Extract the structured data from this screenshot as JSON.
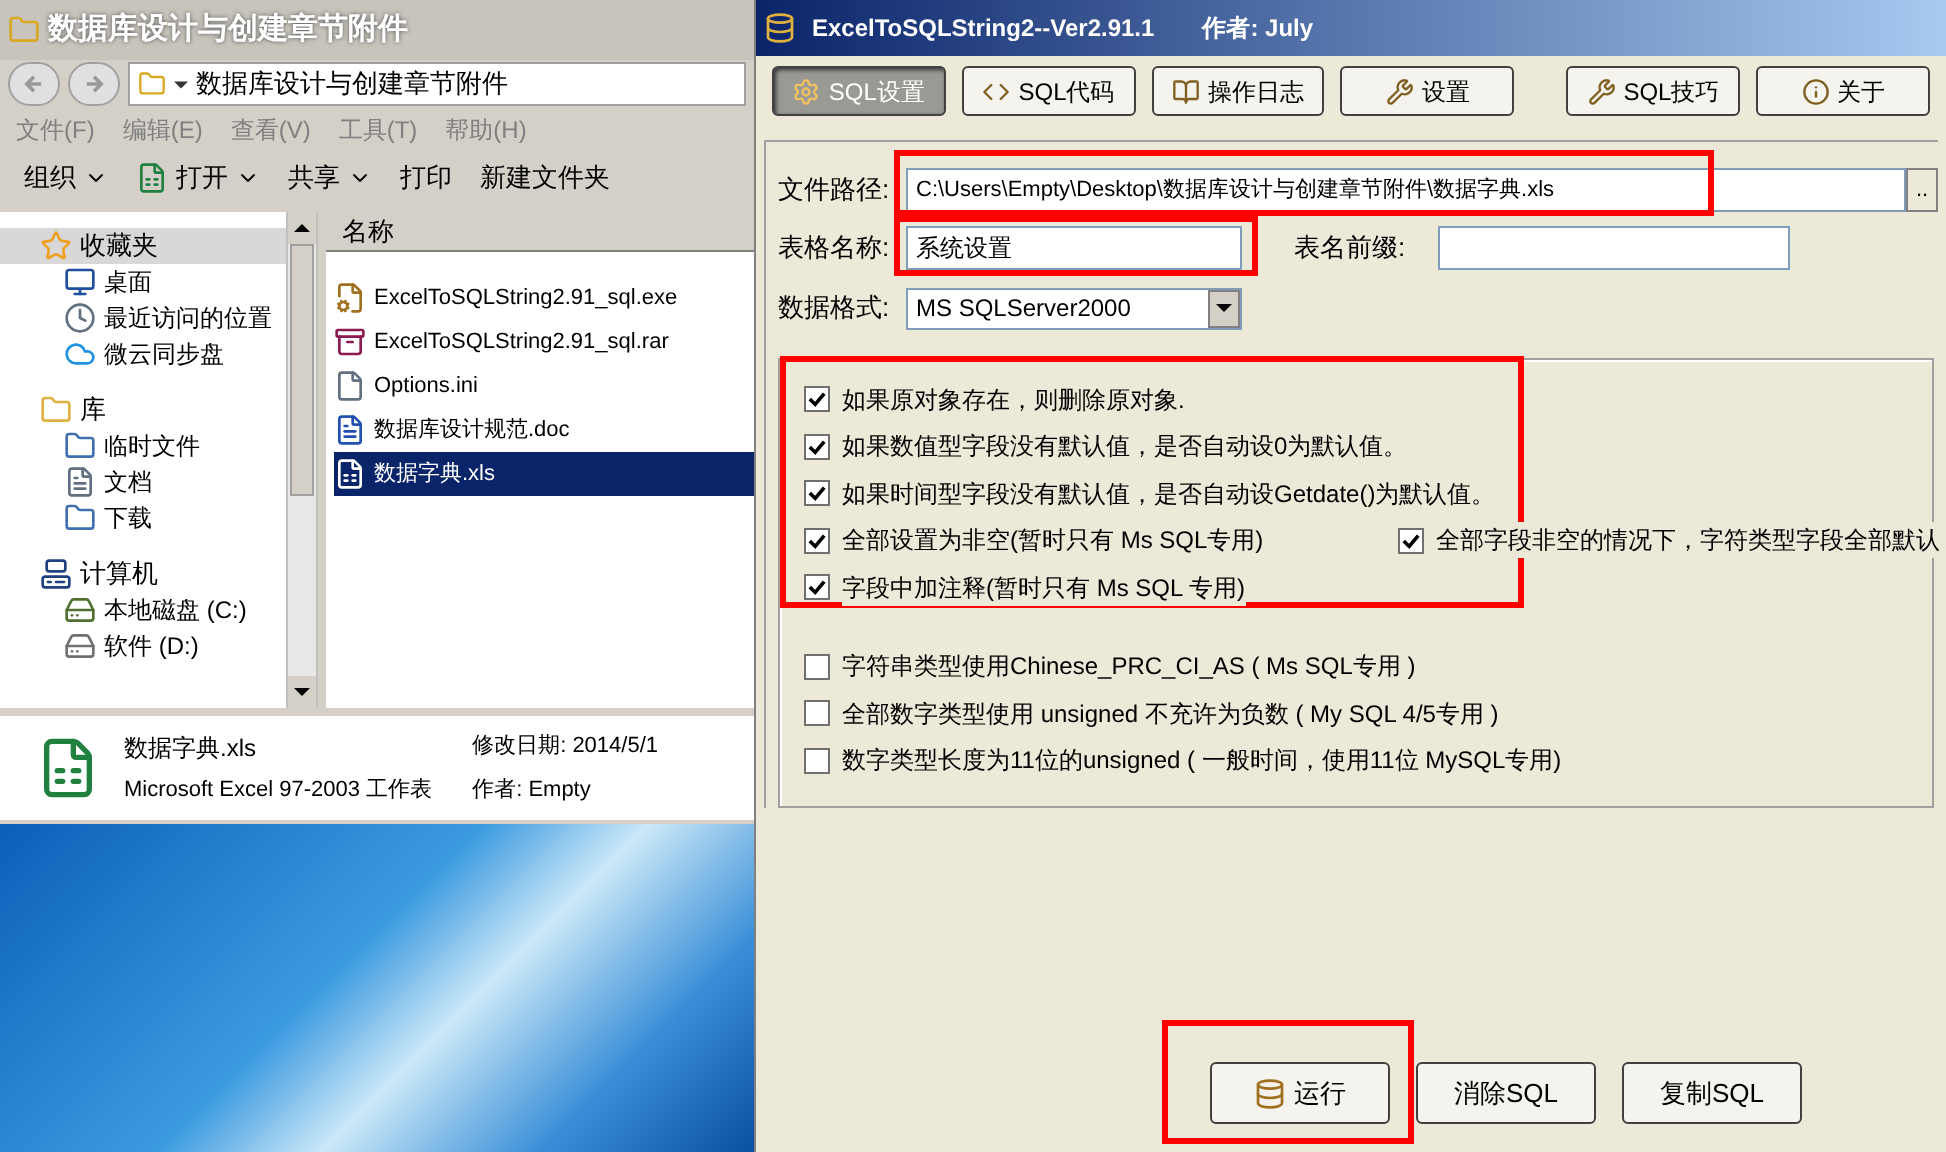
{
  "explorer": {
    "title": "数据库设计与创建章节附件",
    "address": "数据库设计与创建章节附件",
    "menu": [
      "文件(F)",
      "编辑(E)",
      "查看(V)",
      "工具(T)",
      "帮助(H)"
    ],
    "toolbar": [
      {
        "label": "组织",
        "kind": "dropdown"
      },
      {
        "label": "打开",
        "kind": "excel-dropdown"
      },
      {
        "label": "共享",
        "kind": "dropdown"
      },
      {
        "label": "打印",
        "kind": "plain"
      },
      {
        "label": "新建文件夹",
        "kind": "plain"
      }
    ],
    "nav": [
      {
        "label": "收藏夹",
        "kind": "star",
        "selected": true,
        "children": [
          {
            "label": "桌面",
            "kind": "desktop",
            "selected": false
          },
          {
            "label": "最近访问的位置",
            "kind": "recent",
            "selected": false
          },
          {
            "label": "微云同步盘",
            "kind": "cloud",
            "selected": false
          }
        ]
      },
      {
        "label": "库",
        "kind": "library",
        "selected": false,
        "children": [
          {
            "label": "临时文件",
            "kind": "lib",
            "selected": false
          },
          {
            "label": "文档",
            "kind": "doc",
            "selected": false
          },
          {
            "label": "下载",
            "kind": "lib",
            "selected": false
          }
        ]
      },
      {
        "label": "计算机",
        "kind": "computer",
        "selected": false,
        "children": [
          {
            "label": "本地磁盘 (C:)",
            "kind": "sysdrive",
            "selected": false
          },
          {
            "label": "软件 (D:)",
            "kind": "drive",
            "selected": false
          }
        ]
      }
    ],
    "column": "名称",
    "files": [
      {
        "name": "ExcelToSQLString2.91_sql.exe",
        "kind": "exe",
        "selected": false
      },
      {
        "name": "ExcelToSQLString2.91_sql.rar",
        "kind": "rar",
        "selected": false
      },
      {
        "name": "Options.ini",
        "kind": "ini",
        "selected": false
      },
      {
        "name": "数据库设计规范.doc",
        "kind": "doc",
        "selected": false
      },
      {
        "name": "数据字典.xls",
        "kind": "xls",
        "selected": true
      }
    ],
    "details": {
      "name": "数据字典.xls",
      "type": "Microsoft Excel 97-2003 工作表",
      "modified_label": "修改日期:",
      "modified": "2014/5/1",
      "author_label": "作者:",
      "author": "Empty"
    }
  },
  "app": {
    "title": "ExcelToSQLString2--Ver2.91.1",
    "author": "作者: July",
    "tabs": [
      {
        "label": "SQL设置",
        "selected": true
      },
      {
        "label": "SQL代码",
        "selected": false
      },
      {
        "label": "操作日志",
        "selected": false
      },
      {
        "label": "设置",
        "selected": false
      },
      {
        "label": "SQL技巧",
        "selected": false
      },
      {
        "label": "关于",
        "selected": false
      }
    ],
    "path": {
      "label": "文件路径:",
      "value": "C:\\Users\\Empty\\Desktop\\数据库设计与创建章节附件\\数据字典.xls",
      "browse": "..",
      "highlighted": true
    },
    "table_name": {
      "label": "表格名称:",
      "value": "系统设置",
      "highlighted": true
    },
    "prefix": {
      "label": "表名前缀:"
    },
    "format": {
      "label": "数据格式:",
      "value": "MS SQLServer2000"
    },
    "option_groups": [
      {
        "highlighted": true,
        "rows": [
          [
            {
              "label": "如果原对象存在，则删除原对象.",
              "checked": true
            }
          ],
          [
            {
              "label": "如果数值型字段没有默认值，是否自动设0为默认值。",
              "checked": true
            }
          ],
          [
            {
              "label": "如果时间型字段没有默认值，是否自动设Getdate()为默认值。",
              "checked": true
            }
          ],
          [
            {
              "label": "全部设置为非空(暂时只有 Ms SQL专用)",
              "checked": true
            },
            {
              "label": "全部字段非空的情况下，字符类型字段全部默认",
              "checked": true
            }
          ],
          [
            {
              "label": "字段中加注释(暂时只有 Ms SQL 专用)",
              "checked": true
            }
          ]
        ]
      },
      {
        "highlighted": false,
        "rows": [
          [
            {
              "label": "字符串类型使用Chinese_PRC_CI_AS ( Ms SQL专用 )",
              "checked": false
            }
          ],
          [
            {
              "label": "全部数字类型使用 unsigned 不充许为负数 ( My SQL 4/5专用 )",
              "checked": false
            }
          ],
          [
            {
              "label": "数字类型长度为11位的unsigned ( 一般时间，使用11位 MySQL专用)",
              "checked": false
            }
          ]
        ]
      }
    ],
    "buttons": [
      {
        "label": "运行",
        "kind": "run",
        "highlighted": true
      },
      {
        "label": "消除SQL",
        "kind": "plain",
        "highlighted": false
      },
      {
        "label": "复制SQL",
        "kind": "plain",
        "highlighted": false
      }
    ]
  }
}
